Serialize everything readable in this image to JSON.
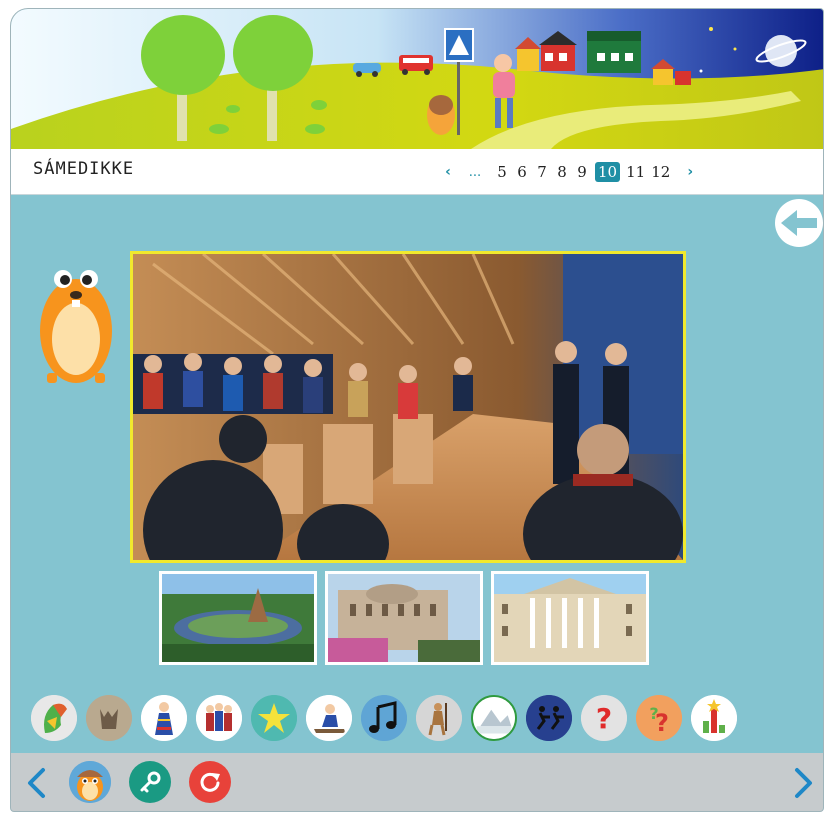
{
  "page": {
    "title": "SÁMEDIKKE"
  },
  "pager": {
    "prev_symbol": "‹",
    "ellipsis": "...",
    "pages": [
      "5",
      "6",
      "7",
      "8",
      "9",
      "10",
      "11",
      "12"
    ],
    "active_page": "10",
    "next_symbol": "›"
  },
  "colors": {
    "page_background": "#84c4d0",
    "accent_teal": "#1f8fa5",
    "photo_border": "#f1e92d",
    "bottom_bar": "#c6cbcd",
    "key_button": "#1a9a83",
    "reload_button": "#e8423a"
  },
  "icons": {
    "back": "arrow-left-icon",
    "categories": [
      "map-icon",
      "reindeer-icon",
      "sami-costume-icon",
      "sami-people-icon",
      "star-icon",
      "reindeer-sled-icon",
      "music-note-icon",
      "hunter-icon",
      "landscape-icon",
      "running-figures-icon",
      "question-mark-icon",
      "quiz-icon",
      "results-icon"
    ],
    "bottom": [
      "chevron-left-icon",
      "mascot-icon",
      "key-icon",
      "reload-icon",
      "chevron-right-icon"
    ]
  }
}
